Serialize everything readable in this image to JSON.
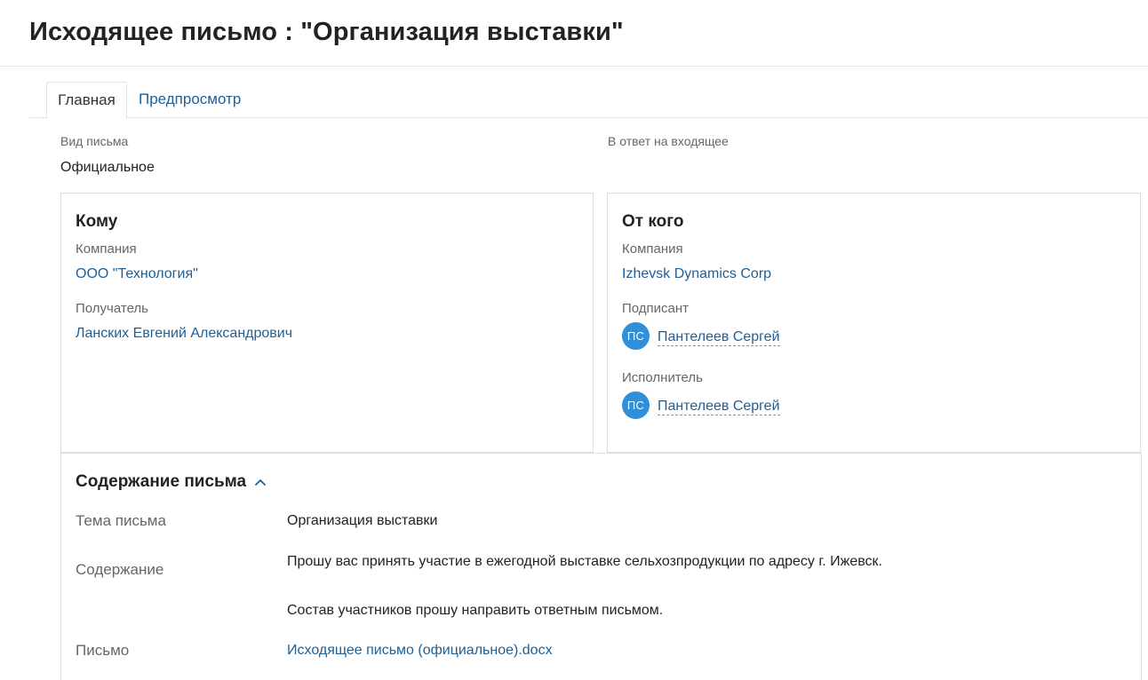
{
  "header": {
    "title": "Исходящее письмо : \"Организация выставки\""
  },
  "tabs": [
    {
      "label": "Главная",
      "active": true
    },
    {
      "label": "Предпросмотр",
      "active": false
    }
  ],
  "fields": {
    "letter_type_label": "Вид письма",
    "letter_type_value": "Официальное",
    "reply_to_label": "В ответ на входящее"
  },
  "to_card": {
    "title": "Кому",
    "company_label": "Компания",
    "company_value": "ООО \"Технология\"",
    "recipient_label": "Получатель",
    "recipient_value": "Ланских Евгений Александрович"
  },
  "from_card": {
    "title": "От кого",
    "company_label": "Компания",
    "company_value": "Izhevsk Dynamics Corp",
    "signer_label": "Подписант",
    "signer_initials": "ПС",
    "signer_name": "Пантелеев Сергей",
    "executor_label": "Исполнитель",
    "executor_initials": "ПС",
    "executor_name": "Пантелеев Сергей"
  },
  "content_section": {
    "title": "Содержание письма",
    "subject_label": "Тема письма",
    "subject_value": "Организация выставки",
    "body_label": "Содержание",
    "body_line1": "Прошу вас принять участие в ежегодной выставке сельхозпродукции по адресу г. Ижевск.",
    "body_line2": "Состав участников прошу направить ответным письмом.",
    "file_label": "Письмо",
    "file_value": "Исходящее письмо (официальное).docx"
  },
  "colors": {
    "link": "#1f5f96",
    "avatar": "#2f8fd8",
    "label": "#666666",
    "border": "#dedede"
  },
  "icons": {
    "section_toggle": "chevron-up-icon"
  }
}
